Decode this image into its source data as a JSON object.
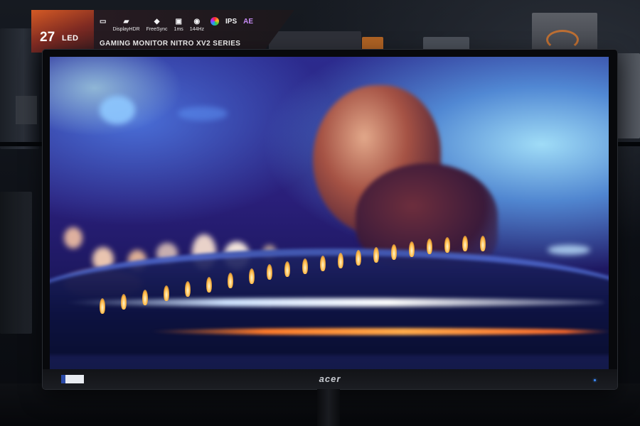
{
  "banner": {
    "size": "27",
    "led_label": "LED",
    "caption": "GAMING MONITOR NITRO XV2 SERIES",
    "icons": [
      {
        "name": "display-icon",
        "label": ""
      },
      {
        "name": "displayhdr-icon",
        "label": "DisplayHDR"
      },
      {
        "name": "freesync-icon",
        "label": "FreeSync"
      },
      {
        "name": "response-time-icon",
        "label": "1ms"
      },
      {
        "name": "refresh-rate-icon",
        "label": "144Hz"
      },
      {
        "name": "color-wheel-icon",
        "label": ""
      },
      {
        "name": "ips-icon",
        "label": "IPS"
      },
      {
        "name": "ae-icon",
        "label": "AE"
      }
    ]
  },
  "monitor": {
    "brand": "acer"
  }
}
